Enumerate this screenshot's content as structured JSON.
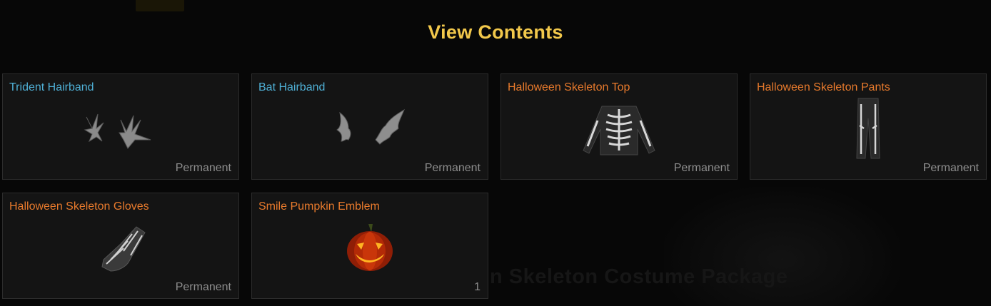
{
  "modal": {
    "title": "View Contents"
  },
  "background": {
    "package_title": "n Skeleton Costume Package"
  },
  "items": [
    {
      "name": "Trident Hairband",
      "duration": "Permanent",
      "rarity_color": "#4fb0d6",
      "icon": "trident-hairband-icon"
    },
    {
      "name": "Bat Hairband",
      "duration": "Permanent",
      "rarity_color": "#4fb0d6",
      "icon": "bat-hairband-icon"
    },
    {
      "name": "Halloween Skeleton Top",
      "duration": "Permanent",
      "rarity_color": "#e87a2c",
      "icon": "skeleton-top-icon"
    },
    {
      "name": "Halloween Skeleton Pants",
      "duration": "Permanent",
      "rarity_color": "#e87a2c",
      "icon": "skeleton-pants-icon"
    },
    {
      "name": "Halloween Skeleton Gloves",
      "duration": "Permanent",
      "rarity_color": "#e87a2c",
      "icon": "skeleton-gloves-icon"
    },
    {
      "name": "Smile Pumpkin Emblem",
      "duration": "1",
      "rarity_color": "#e87a2c",
      "icon": "pumpkin-emblem-icon"
    }
  ],
  "colors": {
    "title": "#f2c84b",
    "uncommon": "#4fb0d6",
    "rare": "#e87a2c",
    "duration_text": "#8d8d8d"
  }
}
